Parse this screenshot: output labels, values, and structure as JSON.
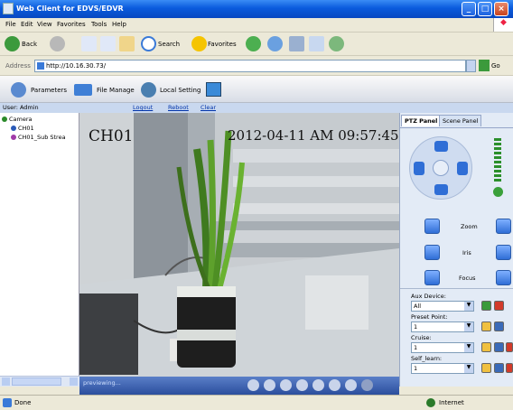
{
  "window": {
    "title": "Web Client for EDVS/EDVR"
  },
  "menu": [
    "File",
    "Edit",
    "View",
    "Favorites",
    "Tools",
    "Help"
  ],
  "toolbar": {
    "back": "Back",
    "search": "Search",
    "favorites": "Favorites"
  },
  "address": {
    "label": "Address",
    "url": "http://10.16.30.73/",
    "go": "Go"
  },
  "app_tools": {
    "parameters": "Parameters",
    "file_manage": "File Manage",
    "local_setting": "Local Setting"
  },
  "userbar": {
    "user": "User: Admin",
    "logout": "Logout",
    "reboot": "Reboot",
    "clear": "Clear"
  },
  "tree": {
    "root": "Camera",
    "items": [
      "CH01",
      "CH01_Sub Strea"
    ]
  },
  "video": {
    "channel": "CH01",
    "timestamp": "2012-04-11 AM 09:57:45",
    "status": "previewing..."
  },
  "ptz": {
    "tabs": [
      "PTZ Panel",
      "Scene Panel"
    ],
    "zoom": "Zoom",
    "iris": "Iris",
    "focus": "Focus",
    "aux_label": "Aux Device:",
    "aux_value": "All",
    "preset_label": "Preset Point:",
    "preset_value": "1",
    "cruise_label": "Cruise:",
    "cruise_value": "1",
    "selflearn_label": "Self_learn:",
    "selflearn_value": "1"
  },
  "status": {
    "left": "Done",
    "zone": "Internet"
  },
  "colors": {
    "titlebar": "#0a5bdd",
    "accent": "#2f6ed6"
  }
}
